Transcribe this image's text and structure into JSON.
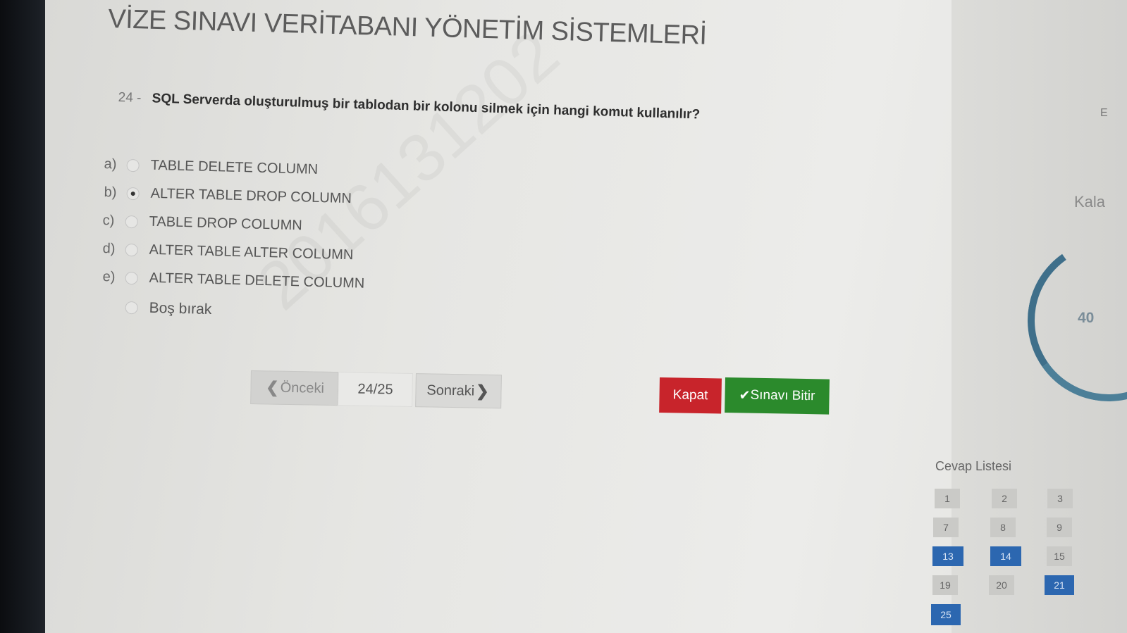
{
  "exam": {
    "title": "VİZE SINAVI VERİTABANI YÖNETİM SİSTEMLERİ"
  },
  "question": {
    "number": "24 -",
    "text": "SQL Serverda oluşturulmuş bir tablodan bir kolonu silmek için hangi komut kullanılır?",
    "options": [
      {
        "letter": "a)",
        "text": "TABLE DELETE COLUMN",
        "selected": false
      },
      {
        "letter": "b)",
        "text": "ALTER TABLE DROP COLUMN",
        "selected": true
      },
      {
        "letter": "c)",
        "text": "TABLE DROP COLUMN",
        "selected": false
      },
      {
        "letter": "d)",
        "text": "ALTER TABLE ALTER COLUMN",
        "selected": false
      },
      {
        "letter": "e)",
        "text": "ALTER TABLE DELETE COLUMN",
        "selected": false
      }
    ],
    "skip_label": "Boş bırak"
  },
  "watermark": "2016131202",
  "nav": {
    "prev_label": "Önceki",
    "counter": "24/25",
    "next_label": "Sonraki"
  },
  "actions": {
    "close_label": "Kapat",
    "finish_label": "Sınavı Bitir"
  },
  "timer": {
    "label": "Kala",
    "value": "40"
  },
  "answer_list": {
    "title": "Cevap Listesi",
    "answered_color": "#2c67b0",
    "items": [
      {
        "num": "1",
        "answered": false
      },
      {
        "num": "2",
        "answered": false
      },
      {
        "num": "3",
        "answered": false
      },
      {
        "num": "7",
        "answered": false
      },
      {
        "num": "8",
        "answered": false
      },
      {
        "num": "9",
        "answered": false
      },
      {
        "num": "13",
        "answered": true
      },
      {
        "num": "14",
        "answered": true
      },
      {
        "num": "15",
        "answered": false
      },
      {
        "num": "19",
        "answered": false
      },
      {
        "num": "20",
        "answered": false
      },
      {
        "num": "21",
        "answered": true
      },
      {
        "num": "25",
        "answered": true
      }
    ]
  }
}
